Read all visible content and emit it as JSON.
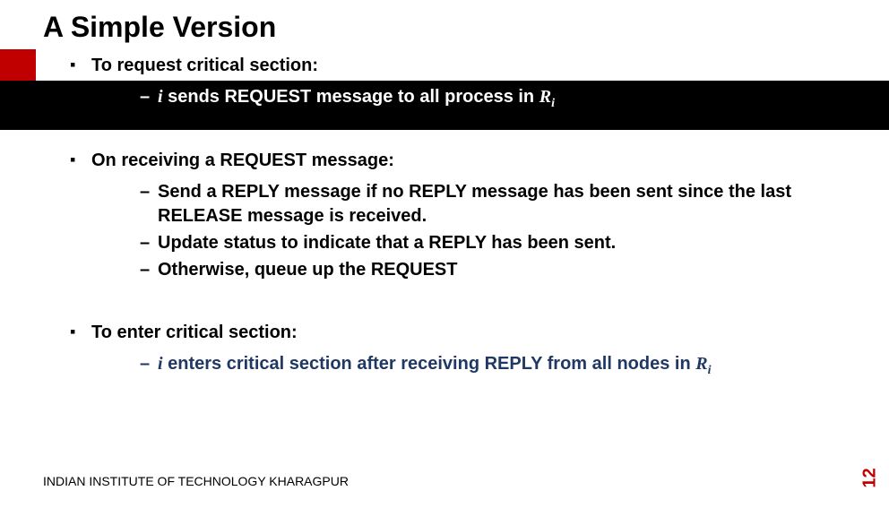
{
  "title": "A Simple Version",
  "section1": {
    "heading": "To request critical section:",
    "item1_prefix": "i",
    "item1_mid": " sends REQUEST message to all process in ",
    "item1_sym": "R",
    "item1_sub": "i"
  },
  "section2": {
    "heading": "On receiving a REQUEST message:",
    "item1": "Send a REPLY message if no REPLY message has been sent since the last RELEASE message is received.",
    "item2": "Update status to indicate that a REPLY has been sent.",
    "item3": "Otherwise, queue up the REQUEST"
  },
  "section3": {
    "heading": "To enter critical section:",
    "item1_prefix": "i",
    "item1_mid": " enters critical section after receiving REPLY from all nodes in ",
    "item1_sym": "R",
    "item1_sub": "i"
  },
  "footer": "INDIAN INSTITUTE OF TECHNOLOGY KHARAGPUR",
  "page": "12"
}
